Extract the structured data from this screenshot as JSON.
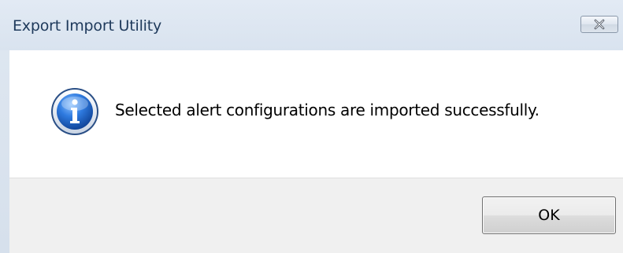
{
  "window": {
    "title": "Export Import Utility",
    "close_icon": "close-icon"
  },
  "message": {
    "icon": "info-icon",
    "text": "Selected alert configurations are imported successfully."
  },
  "buttons": {
    "ok_label": "OK"
  },
  "colors": {
    "titlebar": "#dbe5f0",
    "title_text": "#1e395b",
    "content_bg": "#ffffff",
    "footer_bg": "#f0f0f0",
    "info_icon_blue": "#1f5fb4"
  }
}
